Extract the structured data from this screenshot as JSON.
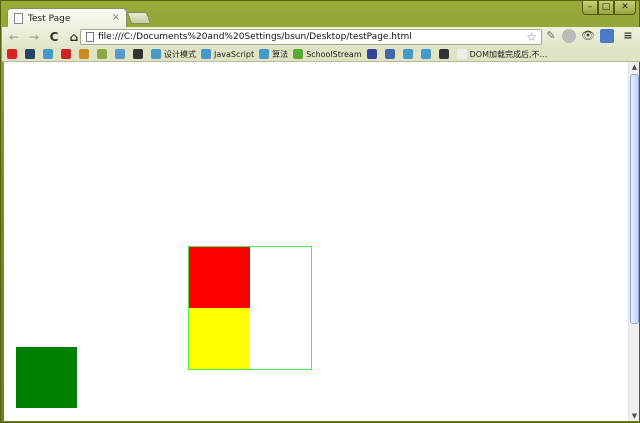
{
  "window": {
    "tab_title": "Test Page",
    "tab_close": "×",
    "min_label": "–",
    "max_label": "□",
    "close_label": "✕"
  },
  "toolbar": {
    "back": "←",
    "forward": "→",
    "reload": "C",
    "home": "⌂",
    "url": "file:///C:/Documents%20and%20Settings/bsun/Desktop/testPage.html",
    "star": "☆",
    "menu": "≡"
  },
  "bookmarks": [
    {
      "label": "",
      "color": "#d22"
    },
    {
      "label": "",
      "color": "#246"
    },
    {
      "label": "",
      "color": "#49c"
    },
    {
      "label": "",
      "color": "#c22"
    },
    {
      "label": "",
      "color": "#c82"
    },
    {
      "label": "",
      "color": "#8a4"
    },
    {
      "label": "",
      "color": "#59c"
    },
    {
      "label": "",
      "color": "#333"
    },
    {
      "label": "设计模式",
      "color": "#49c"
    },
    {
      "label": "JavaScript",
      "color": "#49c"
    },
    {
      "label": "算法",
      "color": "#49c"
    },
    {
      "label": "SchoolStream",
      "color": "#5a3"
    },
    {
      "label": "",
      "color": "#349"
    },
    {
      "label": "",
      "color": "#46a"
    },
    {
      "label": "",
      "color": "#49c"
    },
    {
      "label": "",
      "color": "#49c"
    },
    {
      "label": "",
      "color": "#333"
    },
    {
      "label": "DOM加载完成后,不…",
      "color": "#eee"
    }
  ],
  "colors": {
    "red_box": "#ff0000",
    "yellow_box": "#ffff00",
    "green_box": "#008000",
    "container_border": "#50e850"
  }
}
